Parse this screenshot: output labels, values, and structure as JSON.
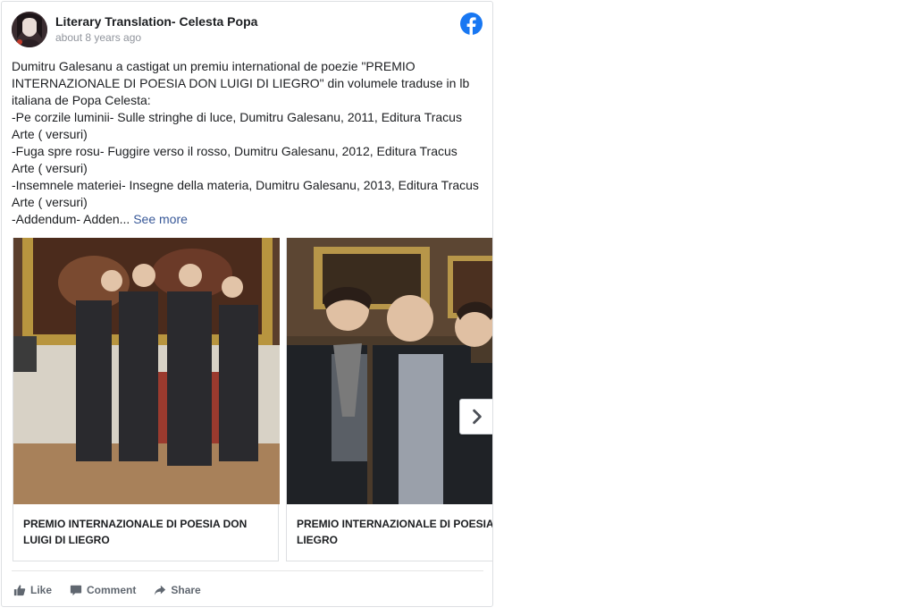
{
  "post": {
    "author": "Literary Translation- Celesta Popa",
    "timestamp": "about 8 years ago",
    "text_lines": [
      "Dumitru Galesanu a castigat un premiu international de poezie \"PREMIO",
      "INTERNAZIONALE DI POESIA DON LUIGI DI LIEGRO\" din volumele traduse in lb",
      "italiana de Popa Celesta:",
      "-Pe corzile luminii- Sulle stringhe di luce, Dumitru Galesanu, 2011, Editura Tracus",
      "Arte ( versuri)",
      "-Fuga spre rosu- Fuggire verso il rosso, Dumitru Galesanu, 2012, Editura Tracus",
      "Arte ( versuri)",
      "-Insemnele materiei- Insegne della materia, Dumitru Galesanu, 2013, Editura Tracus",
      "Arte ( versuri)",
      "-Addendum- Adden..."
    ],
    "see_more": "See more"
  },
  "carousel": {
    "cards": [
      {
        "caption": "PREMIO INTERNAZIONALE DI POESIA DON LUIGI DI LIEGRO"
      },
      {
        "caption": "PREMIO INTERNAZIONALE DI POESIA LUIGI DI LIEGRO"
      }
    ]
  },
  "actions": {
    "like": "Like",
    "comment": "Comment",
    "share": "Share"
  },
  "icons": {
    "facebook": "facebook-logo-icon",
    "next": "chevron-right-icon",
    "like": "thumbs-up-icon",
    "comment": "comment-icon",
    "share": "share-arrow-icon"
  },
  "colors": {
    "facebook_blue": "#1877f2",
    "link": "#385898",
    "muted": "#90949c",
    "action": "#606770"
  }
}
